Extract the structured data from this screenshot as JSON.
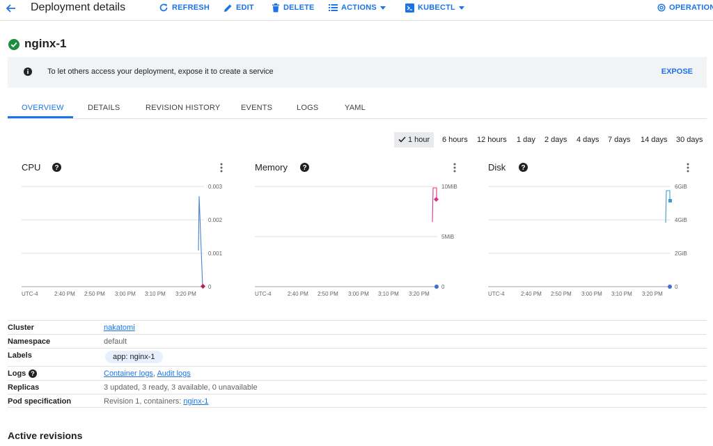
{
  "header": {
    "title": "Deployment details",
    "actions": {
      "refresh": "REFRESH",
      "edit": "EDIT",
      "delete": "DELETE",
      "actions": "ACTIONS",
      "kubectl": "KUBECTL",
      "operations": "OPERATIONS"
    }
  },
  "deployment": {
    "name": "nginx-1",
    "status_icon": "check-circle-icon",
    "status_color": "#1e8e3e"
  },
  "banner": {
    "message": "To let others access your deployment, expose it to create a service",
    "action": "EXPOSE"
  },
  "tabs": [
    "OVERVIEW",
    "DETAILS",
    "REVISION HISTORY",
    "EVENTS",
    "LOGS",
    "YAML"
  ],
  "active_tab": "OVERVIEW",
  "time_ranges": [
    "1 hour",
    "6 hours",
    "12 hours",
    "1 day",
    "2 days",
    "4 days",
    "7 days",
    "14 days",
    "30 days"
  ],
  "selected_range": "1 hour",
  "charts": [
    {
      "title": "CPU",
      "x_ticks": [
        "UTC-4",
        "2:40 PM",
        "2:50 PM",
        "3:00 PM",
        "3:10 PM",
        "3:20 PM"
      ],
      "y_ticks": [
        "0.003",
        "0.002",
        "0.001",
        "0"
      ],
      "line_color": "#4a7fd1",
      "marker_color": "#c2185b"
    },
    {
      "title": "Memory",
      "x_ticks": [
        "UTC-4",
        "2:40 PM",
        "2:50 PM",
        "3:00 PM",
        "3:10 PM",
        "3:20 PM"
      ],
      "y_ticks": [
        "10MiB",
        "5MiB",
        "0"
      ],
      "line_color": "#d4348a",
      "marker_color": "#d4348a"
    },
    {
      "title": "Disk",
      "x_ticks": [
        "UTC-4",
        "2:40 PM",
        "2:50 PM",
        "3:00 PM",
        "3:10 PM",
        "3:20 PM"
      ],
      "y_ticks": [
        "6GiB",
        "4GiB",
        "2GiB",
        "0"
      ],
      "line_color": "#3d9ec7",
      "marker_color": "#3d9ec7"
    }
  ],
  "details": {
    "cluster_label": "Cluster",
    "cluster": "nakatomi",
    "namespace_label": "Namespace",
    "namespace": "default",
    "labels_label": "Labels",
    "label_chip": "app: nginx-1",
    "logs_label": "Logs",
    "container_logs": "Container logs",
    "logs_sep": ",",
    "audit_logs": "Audit logs",
    "replicas_label": "Replicas",
    "replicas": "3 updated, 3 ready, 3 available, 0 unavailable",
    "pod_spec_label": "Pod specification",
    "pod_spec_prefix": "Revision 1, containers:",
    "pod_spec_container": "nginx-1"
  },
  "active_revisions_title": "Active revisions"
}
